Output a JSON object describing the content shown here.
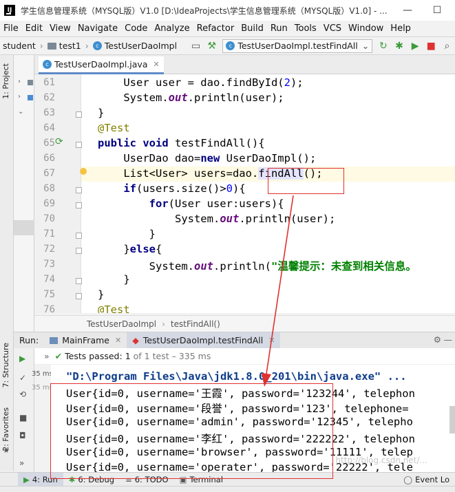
{
  "window": {
    "title": "学生信息管理系统（MYSQL版）V1.0 [D:\\IdeaProjects\\学生信息管理系统（MYSQL版）V1.0] - ...",
    "logo": "IJ"
  },
  "menu": [
    "File",
    "Edit",
    "View",
    "Navigate",
    "Code",
    "Analyze",
    "Refactor",
    "Build",
    "Run",
    "Tools",
    "VCS",
    "Window",
    "Help"
  ],
  "nav": {
    "project": "student",
    "folder": "test1",
    "class": "TestUserDaoImpl",
    "run_config": "TestUserDaoImpl.testFindAll"
  },
  "side_tabs": {
    "project": "1: Project",
    "structure": "7: Structure",
    "favorites": "2: Favorites"
  },
  "editor_tab": {
    "label": "TestUserDaoImpl.java"
  },
  "code_lines": [
    61,
    62,
    63,
    64,
    65,
    66,
    67,
    68,
    69,
    70,
    71,
    72,
    73,
    74,
    75,
    76
  ],
  "breadcrumb": {
    "class": "TestUserDaoImpl",
    "method": "testFindAll()"
  },
  "run_panel": {
    "label": "Run:",
    "tabs": [
      "MainFrame",
      "TestUserDaoImpl.testFindAll"
    ],
    "tests_passed": "Tests passed:",
    "count": "1",
    "detail": "of 1 test – 335 ms",
    "time1": "35 ms",
    "time2": "35 ms",
    "cmd": "\"D:\\Program Files\\Java\\jdk1.8.0_201\\bin\\java.exe\" ...",
    "output": [
      "User{id=0, username='王霞', password='123244', telephon",
      "User{id=0, username='段誉', password='123', telephone=",
      "User{id=0, username='admin', password='12345', telepho",
      "User{id=0, username='李红', password='222222', telephon",
      "User{id=0, username='browser', password='11111', telep",
      "User{id=0, username='operater', password='22222', tele"
    ]
  },
  "bottom_tabs": [
    "4: Run",
    "6: Debug",
    "6: TODO",
    "Terminal",
    "Event Lo"
  ],
  "watermark": "http://blog.csdn.net/..."
}
